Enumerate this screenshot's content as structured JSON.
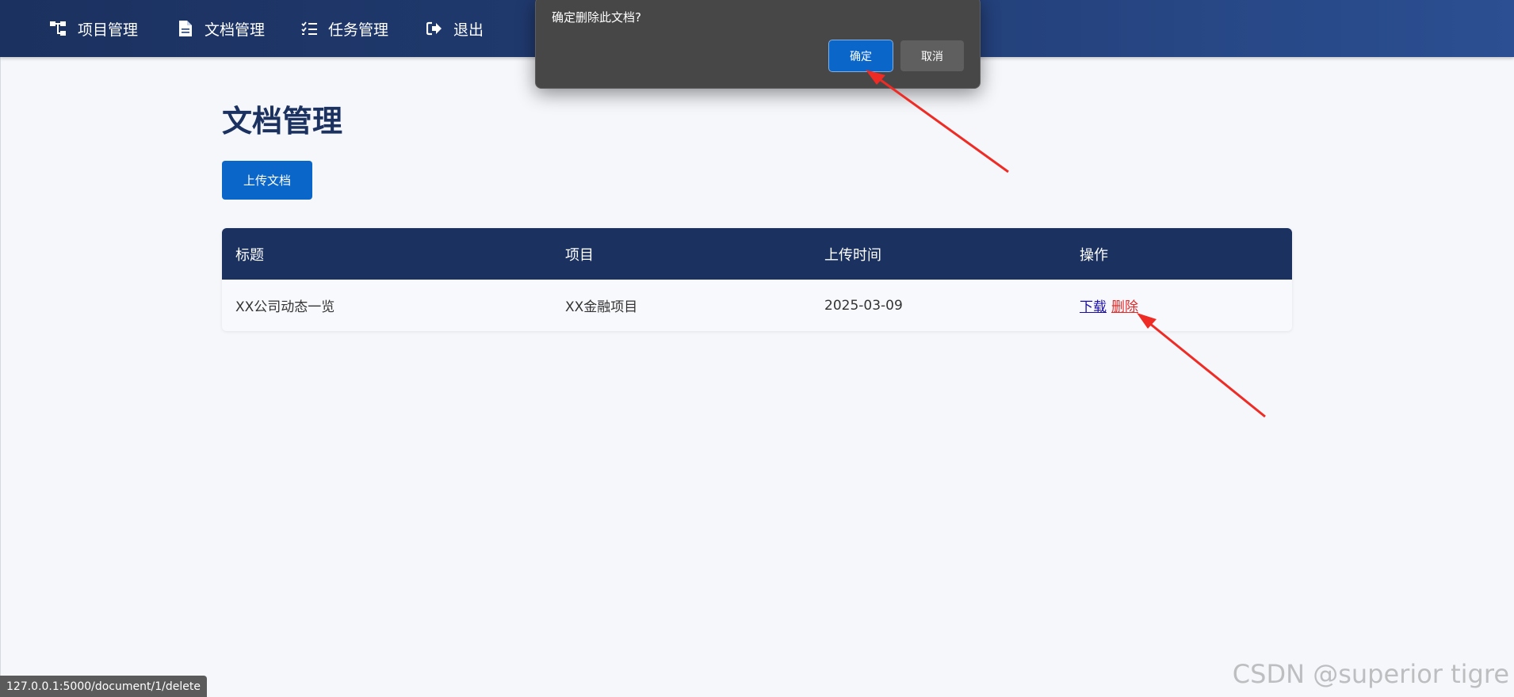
{
  "nav": {
    "items": [
      {
        "label": "项目管理",
        "icon": "sitemap-icon"
      },
      {
        "label": "文档管理",
        "icon": "file-icon"
      },
      {
        "label": "任务管理",
        "icon": "tasks-icon"
      },
      {
        "label": "退出",
        "icon": "sign-out-icon"
      }
    ]
  },
  "page": {
    "title": "文档管理",
    "upload_label": "上传文档"
  },
  "table": {
    "headers": [
      "标题",
      "项目",
      "上传时间",
      "操作"
    ],
    "rows": [
      {
        "title": "XX公司动态一览",
        "project": "XX金融项目",
        "uploaded": "2025-03-09",
        "download_label": "下载",
        "delete_label": "删除"
      }
    ]
  },
  "dialog": {
    "message": "确定删除此文档?",
    "ok_label": "确定",
    "cancel_label": "取消"
  },
  "status_bar": {
    "url": "127.0.0.1:5000/document/1/delete"
  },
  "watermark": "CSDN @superior tigre",
  "colors": {
    "nav_bg": "#1b315f",
    "primary": "#0a66c9",
    "delete_link": "#e12a2a",
    "download_link": "#1a0dab",
    "annotation_arrow": "#ee2b24",
    "dialog_bg": "#474747"
  }
}
